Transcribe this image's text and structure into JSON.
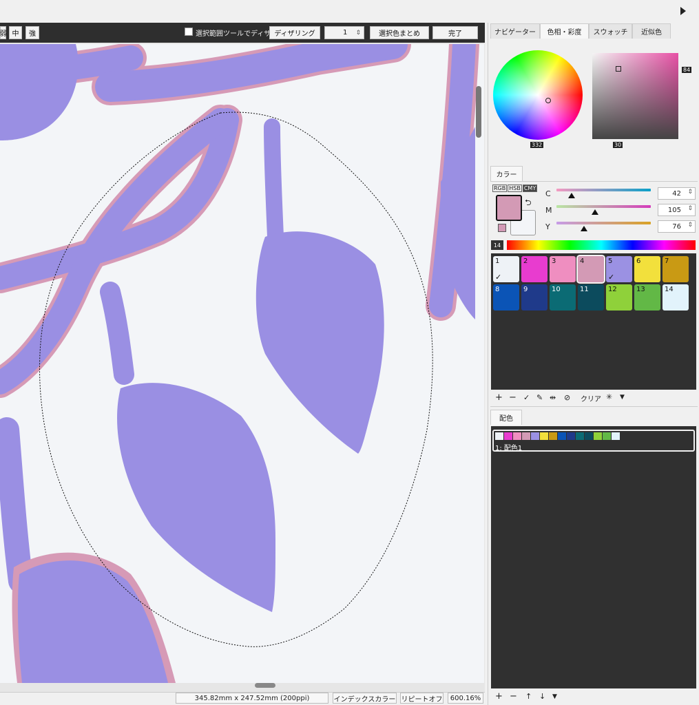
{
  "toolbar": {
    "btn_partial": "弱",
    "btn_mid": "中",
    "btn_strong": "強",
    "checkbox_label": "選択範囲ツールでディザ",
    "dither_label": "ディザリング",
    "dither_value": "1",
    "merge_label": "選択色まとめ",
    "done_label": "完了"
  },
  "status": {
    "size": "345.82mm x 247.52mm (200ppi)",
    "mode": "インデックスカラー",
    "repeat": "リピートオフ",
    "zoom": "600.16%"
  },
  "tabs": {
    "navigator": "ナビゲーター",
    "hue": "色相・彩度",
    "swatch": "スウォッチ",
    "similar": "近似色"
  },
  "wheel": {
    "hue_value": "332",
    "square_bottom": "30",
    "square_side": "84"
  },
  "color_panel": {
    "tab": "カラー",
    "modes": [
      "RGB",
      "HSB",
      "CMY"
    ],
    "channels": [
      {
        "label": "C",
        "value": "42"
      },
      {
        "label": "M",
        "value": "105"
      },
      {
        "label": "Y",
        "value": "76"
      }
    ],
    "index_label": "14",
    "main_color": "#d39ab5"
  },
  "palette": [
    {
      "num": "1",
      "color": "#eef2f6",
      "check": "✓",
      "text": "#111"
    },
    {
      "num": "2",
      "color": "#e83ccf",
      "check": "",
      "text": "#111"
    },
    {
      "num": "3",
      "color": "#ef8ec0",
      "check": "",
      "text": "#111"
    },
    {
      "num": "4",
      "color": "#d39ab5",
      "check": "",
      "text": "#111"
    },
    {
      "num": "5",
      "color": "#9b91e3",
      "check": "✓",
      "text": "#111"
    },
    {
      "num": "6",
      "color": "#f2e03c",
      "check": "",
      "text": "#111"
    },
    {
      "num": "7",
      "color": "#c99a14",
      "check": "",
      "text": "#111"
    },
    {
      "num": "8",
      "color": "#0b54b6",
      "check": "",
      "text": "#fff"
    },
    {
      "num": "9",
      "color": "#1f3a8a",
      "check": "",
      "text": "#fff"
    },
    {
      "num": "10",
      "color": "#0b6b74",
      "check": "",
      "text": "#fff"
    },
    {
      "num": "11",
      "color": "#0c4b5d",
      "check": "",
      "text": "#fff"
    },
    {
      "num": "12",
      "color": "#8fd13a",
      "check": "",
      "text": "#111"
    },
    {
      "num": "13",
      "color": "#62b846",
      "check": "",
      "text": "#111"
    },
    {
      "num": "14",
      "color": "#e2f3fb",
      "check": "",
      "text": "#111"
    }
  ],
  "palette_tools": {
    "clear": "クリア"
  },
  "scheme": {
    "tab": "配色",
    "item_label": "1: 配色1"
  }
}
